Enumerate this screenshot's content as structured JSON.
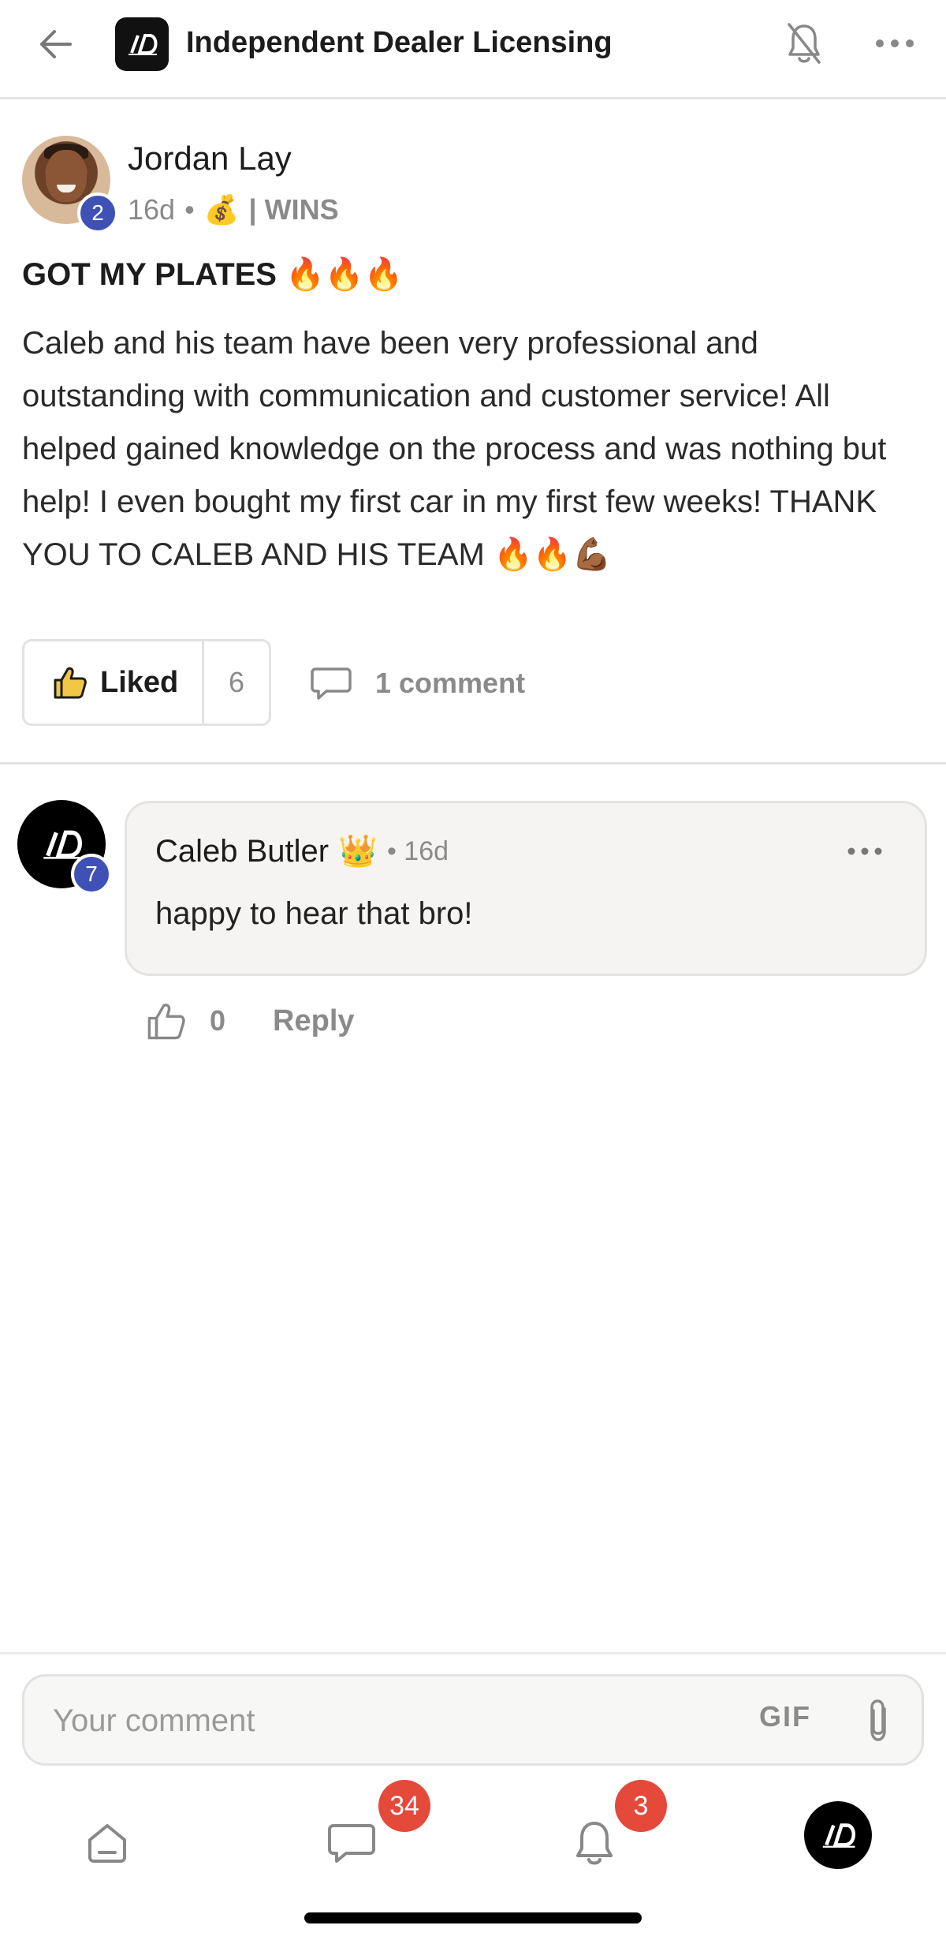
{
  "header": {
    "title": "Independent Dealer Licensing",
    "back_icon": "arrow-left-icon",
    "bell_icon": "bell-off-icon",
    "more_icon": "more-horizontal-icon",
    "logo_text": "ID"
  },
  "post": {
    "author": "Jordan Lay",
    "author_level": "2",
    "time": "16d",
    "meta_separator": "•",
    "category_emoji": "💰",
    "category": "| WINS",
    "title": "GOT MY PLATES 🔥🔥🔥",
    "body": "Caleb and his team have been very professional and outstanding with communication and customer service! All helped gained knowledge on the process and was nothing but help! I even bought my first car in my first few weeks! THANK YOU TO CALEB AND HIS TEAM 🔥🔥💪🏾",
    "like_label": "Liked",
    "like_count": "6",
    "comments_label": "1 comment"
  },
  "comment": {
    "author": "Caleb Butler",
    "author_badge": "👑",
    "author_level": "7",
    "time": "• 16d",
    "text": "happy to hear that bro!",
    "like_count": "0",
    "reply_label": "Reply"
  },
  "composer": {
    "placeholder": "Your comment",
    "gif_label": "GIF"
  },
  "bottom_nav": {
    "chat_badge": "34",
    "notifications_badge": "3"
  },
  "colors": {
    "accent_badge": "#3f51b5",
    "notification_red": "#e5493a",
    "muted_text": "#8a8a8a"
  }
}
